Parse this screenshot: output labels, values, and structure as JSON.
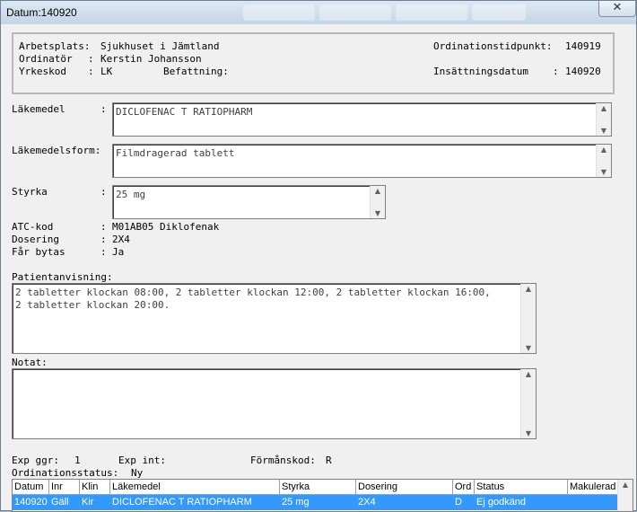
{
  "window": {
    "title": "Datum:140920",
    "close_icon": "close-icon"
  },
  "header": {
    "arbetsplats_label": "Arbetsplats:",
    "arbetsplats_value": "Sjukhuset i Jämtland",
    "ordinator_label": "Ordinatör",
    "ordinator_value": "Kerstin Johansson",
    "yrkeskod_label": "Yrkeskod",
    "yrkeskod_value": "LK",
    "befattning_label": "Befattning:",
    "befattning_value": "",
    "ordinationstidpunkt_label": "Ordinationstidpunkt:",
    "ordinationstidpunkt_value": "140919",
    "insattningsdatum_label": "Insättningsdatum",
    "insattningsdatum_value": "140920"
  },
  "lakemedel": {
    "label": "Läkemedel",
    "value": "DICLOFENAC T RATIOPHARM"
  },
  "lakemedelsform": {
    "label": "Läkemedelsform:",
    "value": "Filmdragerad tablett"
  },
  "styrka": {
    "label": "Styrka",
    "value": "25 mg"
  },
  "atc": {
    "label": "ATC-kod",
    "value": "M01AB05 Diklofenak"
  },
  "dosering": {
    "label": "Dosering",
    "value": "2X4"
  },
  "far_bytas": {
    "label": "Får bytas",
    "value": "Ja"
  },
  "patientanvisning": {
    "label": "Patientanvisning:",
    "value": "2 tabletter klockan 08:00, 2 tabletter klockan 12:00, 2 tabletter klockan 16:00,\n2 tabletter klockan 20:00."
  },
  "notat": {
    "label": "Notat:",
    "value": ""
  },
  "footer": {
    "exp_ggr_label": "Exp ggr:",
    "exp_ggr_value": "1",
    "exp_int_label": "Exp int:",
    "exp_int_value": "",
    "formanskod_label": "Förmånskod:",
    "formanskod_value": "R",
    "status_label": "Ordinationsstatus:",
    "status_value": "Ny"
  },
  "grid": {
    "columns": [
      "Datum",
      "Inr",
      "Klin",
      "Läkemedel",
      "Styrka",
      "Dosering",
      "Ord",
      "Status",
      "Makulerad"
    ],
    "rows": [
      [
        "140920",
        "Gäll",
        "Kir",
        "DICLOFENAC T RATIOPHARM",
        "25 mg",
        "2X4",
        "D",
        "Ej godkänd",
        ""
      ]
    ]
  },
  "colors": {
    "selection": "#3399ff",
    "window_bg": "#f0f0f0"
  }
}
